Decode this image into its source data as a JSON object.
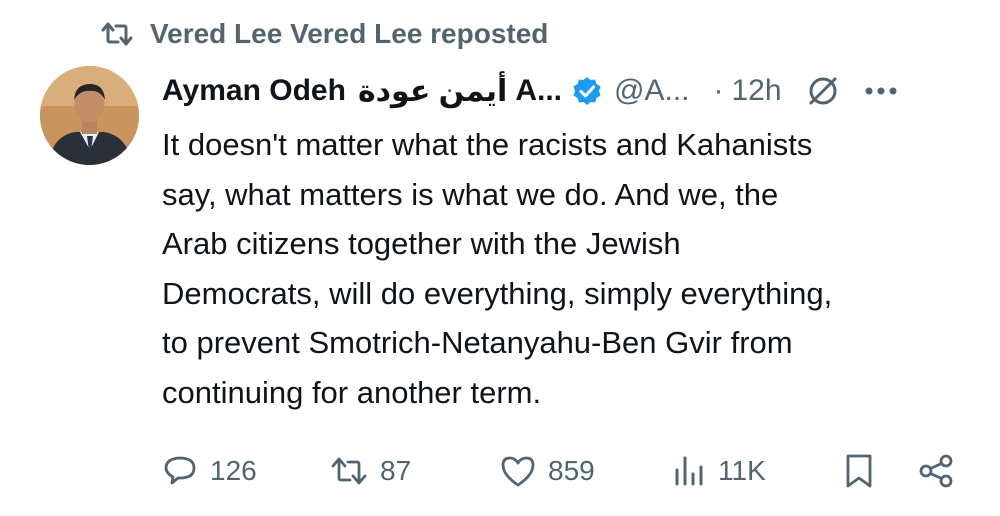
{
  "repost": {
    "text": "Vered Lee Vered Lee reposted"
  },
  "author": {
    "name": "Ayman Odeh",
    "name_arabic": "أيمن عودة",
    "name_more": "A...",
    "handle": "@A...",
    "separator": "·",
    "time": "12h"
  },
  "tweet": {
    "lines": [
      "It doesn't matter what the racists and Kahanists",
      "say, what matters is what we do. And we, the",
      "Arab citizens together with the Jewish",
      "Democrats, will do everything, simply everything,",
      "to prevent Smotrich-Netanyahu-Ben Gvir from",
      "continuing for another term."
    ]
  },
  "actions": {
    "replies": "126",
    "reposts": "87",
    "likes": "859",
    "views": "11K"
  },
  "colors": {
    "text": "#0f1419",
    "muted": "#536471",
    "verified": "#1d9bf0"
  },
  "icons": {
    "repost": "repost-icon",
    "verified": "verified-badge-icon",
    "grok": "grok-icon",
    "more": "more-icon",
    "reply": "reply-icon",
    "like": "like-icon",
    "views": "views-icon",
    "bookmark": "bookmark-icon",
    "share": "share-icon"
  }
}
